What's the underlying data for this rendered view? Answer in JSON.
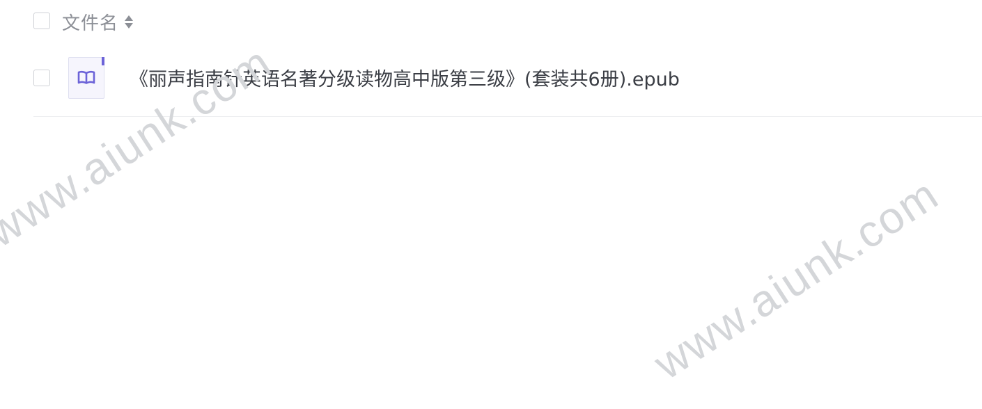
{
  "header": {
    "column_name_label": "文件名",
    "sort_icon": "sort-both-icon"
  },
  "files": [
    {
      "name": "《丽声指南针英语名著分级读物高中版第三级》(套装共6册).epub",
      "icon": "book-icon",
      "icon_color": "#6c63d8"
    }
  ],
  "watermarks": [
    "www.aiunk.com",
    "www.aiunk.com"
  ],
  "colors": {
    "header_text": "#8c8f96",
    "file_text": "#3a3d44",
    "accent": "#6c63d8",
    "divider": "#eeeff1",
    "watermark": "#d4d6d9"
  }
}
